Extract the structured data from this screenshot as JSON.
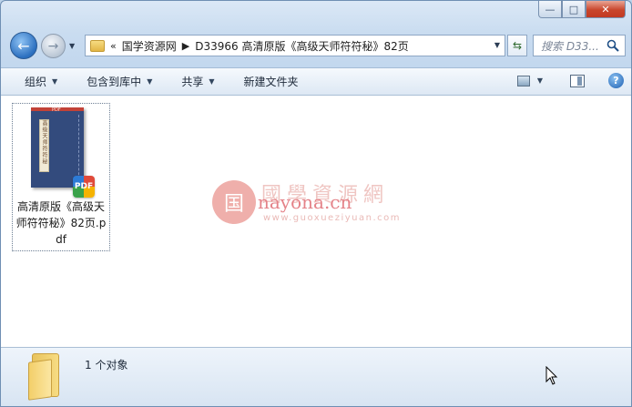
{
  "window": {
    "caption": {
      "minimize": "—",
      "maximize": "□",
      "close": "✕"
    }
  },
  "nav": {
    "back_icon": "arrow-left-icon",
    "forward_icon": "arrow-right-icon",
    "breadcrumb_overflow": "«",
    "breadcrumb": [
      "国学资源网",
      "D33966 高清原版《高级天师符符秘》82页"
    ],
    "search_placeholder": "搜索 D33..."
  },
  "toolbar": {
    "organize": "组织",
    "include_in_library": "包含到库中",
    "share": "共享",
    "new_folder": "新建文件夹"
  },
  "files": [
    {
      "name": "高清原版《高级天师符符秘》82页.pdf",
      "cover_title": "高级天师符符秘",
      "cover_tag": "PDF",
      "badge": "PDF"
    }
  ],
  "watermark": {
    "seal_char": "国",
    "title": "國學資源網",
    "domain": "nayona.cn",
    "url": "www.guoxueziyuan.com"
  },
  "details": {
    "status": "1 个对象"
  },
  "colors": {
    "accent": "#2b6fbf",
    "close_red": "#c9462c",
    "pdf_cover": "#334b7d"
  }
}
